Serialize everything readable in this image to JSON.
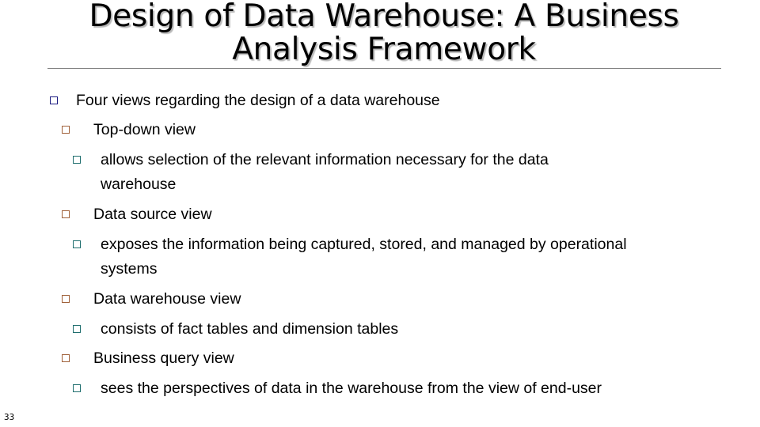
{
  "slide": {
    "title_lines": [
      "Design of Data Warehouse: A Business",
      "Analysis Framework"
    ],
    "page_number": "33",
    "bullet_icon": "hollow-square-bullet-icon",
    "bullet_colors": {
      "level1": "#1a1a80",
      "level2": "#a0613a",
      "level3": "#1f6e6e"
    },
    "content": {
      "intro": "Four views regarding the design of a data warehouse",
      "views": [
        {
          "name": "Top-down view",
          "description_lines": [
            "allows selection of the relevant information necessary for the data",
            "warehouse"
          ]
        },
        {
          "name": "Data source view",
          "description_lines": [
            "exposes the information being captured, stored, and managed by operational",
            "systems"
          ]
        },
        {
          "name": "Data warehouse view",
          "description_lines": [
            "consists of fact tables and dimension tables"
          ]
        },
        {
          "name": "Business query view",
          "description_lines": [
            "sees the perspectives of data in the warehouse from the view of end-user"
          ]
        }
      ]
    }
  }
}
